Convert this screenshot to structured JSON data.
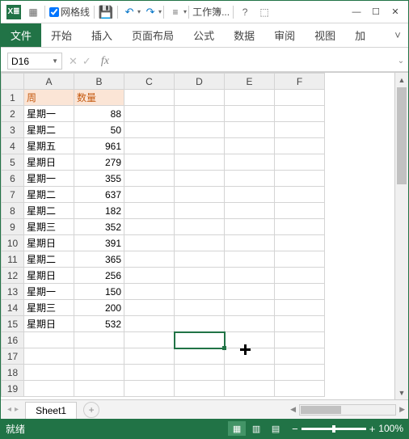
{
  "titlebar": {
    "gridlines_label": "网格线",
    "workbook_title": "工作簿...",
    "gridlines_checked": true
  },
  "ribbon": {
    "tabs": [
      "文件",
      "开始",
      "插入",
      "页面布局",
      "公式",
      "数据",
      "审阅",
      "视图",
      "加"
    ]
  },
  "namebox": {
    "value": "D16"
  },
  "columns": [
    "A",
    "B",
    "C",
    "D",
    "E",
    "F"
  ],
  "headers": {
    "col_a": "周",
    "col_b": "数量"
  },
  "rows": [
    {
      "n": 1,
      "a": "周",
      "b": "数量",
      "header": true
    },
    {
      "n": 2,
      "a": "星期一",
      "b": 88
    },
    {
      "n": 3,
      "a": "星期二",
      "b": 50
    },
    {
      "n": 4,
      "a": "星期五",
      "b": 961
    },
    {
      "n": 5,
      "a": "星期日",
      "b": 279
    },
    {
      "n": 6,
      "a": "星期一",
      "b": 355
    },
    {
      "n": 7,
      "a": "星期二",
      "b": 637
    },
    {
      "n": 8,
      "a": "星期二",
      "b": 182
    },
    {
      "n": 9,
      "a": "星期三",
      "b": 352
    },
    {
      "n": 10,
      "a": "星期日",
      "b": 391
    },
    {
      "n": 11,
      "a": "星期二",
      "b": 365
    },
    {
      "n": 12,
      "a": "星期日",
      "b": 256
    },
    {
      "n": 13,
      "a": "星期一",
      "b": 150
    },
    {
      "n": 14,
      "a": "星期三",
      "b": 200
    },
    {
      "n": 15,
      "a": "星期日",
      "b": 532
    },
    {
      "n": 16,
      "a": "",
      "b": ""
    },
    {
      "n": 17,
      "a": "",
      "b": ""
    },
    {
      "n": 18,
      "a": "",
      "b": ""
    },
    {
      "n": 19,
      "a": "",
      "b": ""
    }
  ],
  "selected_cell": "D16",
  "sheet_tab": "Sheet1",
  "status": {
    "ready": "就绪",
    "zoom": "100%"
  }
}
